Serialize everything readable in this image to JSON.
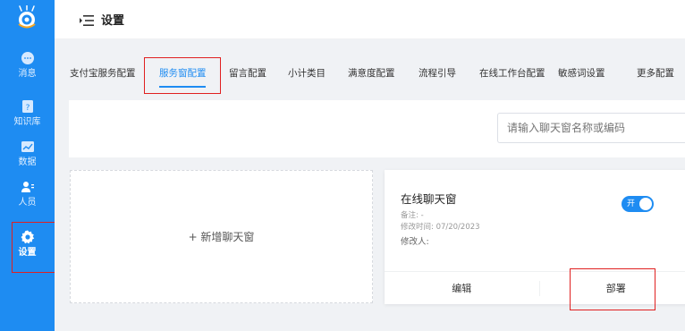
{
  "header": {
    "title": "设置"
  },
  "sidebar": {
    "items": [
      {
        "label": "消息",
        "icon": "chat-bubble-icon"
      },
      {
        "label": "知识库",
        "icon": "book-icon"
      },
      {
        "label": "数据",
        "icon": "chart-icon"
      },
      {
        "label": "人员",
        "icon": "user-list-icon"
      },
      {
        "label": "设置",
        "icon": "gear-icon",
        "active": true
      }
    ]
  },
  "tabs": [
    {
      "label": "支付宝服务配置"
    },
    {
      "label": "服务窗配置",
      "active": true
    },
    {
      "label": "留言配置"
    },
    {
      "label": "小计类目"
    },
    {
      "label": "满意度配置"
    },
    {
      "label": "流程引导"
    },
    {
      "label": "在线工作台配置"
    },
    {
      "label": "敏感词设置"
    },
    {
      "label": "更多配置"
    }
  ],
  "search": {
    "placeholder": "请输入聊天窗名称或编码"
  },
  "add_card": {
    "label": "+ 新增聊天窗"
  },
  "chat_card": {
    "title": "在线聊天窗",
    "remark": "备注: -",
    "modified_time": "修改时间: 07/20/2023",
    "modifier": "修改人:",
    "toggle_label": "开",
    "toggle_on": true,
    "edit_label": "编辑",
    "deploy_label": "部署"
  },
  "colors": {
    "accent": "#1e8cf2",
    "highlight": "#e02020",
    "background": "#f0f2f5"
  }
}
